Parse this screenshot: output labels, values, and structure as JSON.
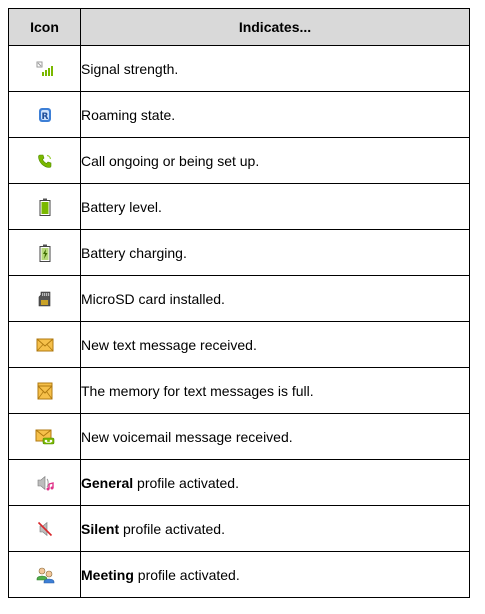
{
  "header": {
    "icon": "Icon",
    "indicates": "Indicates..."
  },
  "rows": [
    {
      "icon": "signal-strength-icon",
      "bold": "",
      "text": "Signal strength."
    },
    {
      "icon": "roaming-icon",
      "bold": "",
      "text": "Roaming state."
    },
    {
      "icon": "call-icon",
      "bold": "",
      "text": "Call ongoing or being set up."
    },
    {
      "icon": "battery-icon",
      "bold": "",
      "text": "Battery level."
    },
    {
      "icon": "battery-charging-icon",
      "bold": "",
      "text": "Battery charging."
    },
    {
      "icon": "microsd-icon",
      "bold": "",
      "text": "MicroSD card installed."
    },
    {
      "icon": "message-icon",
      "bold": "",
      "text": "New text message received."
    },
    {
      "icon": "message-full-icon",
      "bold": "",
      "text": "The memory for text messages is full."
    },
    {
      "icon": "voicemail-icon",
      "bold": "",
      "text": "New voicemail message received."
    },
    {
      "icon": "general-profile-icon",
      "bold": "General",
      "text": " profile activated."
    },
    {
      "icon": "silent-profile-icon",
      "bold": "Silent",
      "text": " profile activated."
    },
    {
      "icon": "meeting-profile-icon",
      "bold": "Meeting",
      "text": " profile activated."
    }
  ],
  "colors": {
    "header_bg": "#d9d9d9",
    "green": "#7ab800",
    "envelope": "#f6c04a",
    "roaming": "#3d7fd6"
  }
}
